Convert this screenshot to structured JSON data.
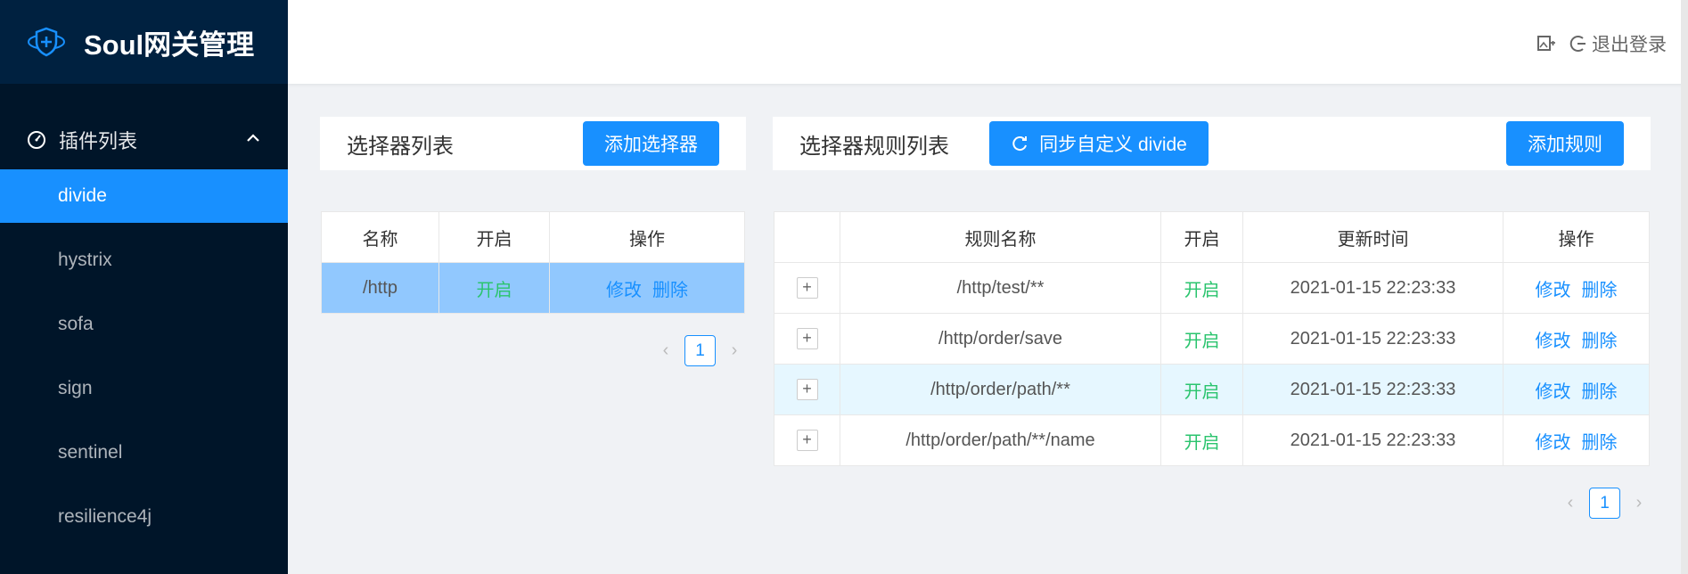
{
  "app": {
    "title": "Soul网关管理",
    "logo_icon": "shield-plus-icon"
  },
  "sidebar": {
    "group_label": "插件列表",
    "group_icon": "dashboard-icon",
    "items": [
      {
        "label": "divide",
        "active": true
      },
      {
        "label": "hystrix"
      },
      {
        "label": "sofa"
      },
      {
        "label": "sign"
      },
      {
        "label": "sentinel"
      },
      {
        "label": "resilience4j"
      }
    ]
  },
  "header": {
    "logout_label": "退出登录",
    "toggle_icon": "image-text-icon",
    "logout_icon": "logout-icon"
  },
  "selector_panel": {
    "title": "选择器列表",
    "add_button": "添加选择器",
    "columns": [
      "名称",
      "开启",
      "操作"
    ],
    "rows": [
      {
        "name": "/http",
        "enabled": "开启",
        "edit": "修改",
        "delete": "删除"
      }
    ],
    "page": "1"
  },
  "rule_panel": {
    "title": "选择器规则列表",
    "sync_button": "同步自定义 divide",
    "add_button": "添加规则",
    "columns": [
      "规则名称",
      "开启",
      "更新时间",
      "操作"
    ],
    "rows": [
      {
        "expand": "+",
        "name": "/http/test/**",
        "enabled": "开启",
        "updated": "2021-01-15 22:23:33",
        "edit": "修改",
        "delete": "删除"
      },
      {
        "expand": "+",
        "name": "/http/order/save",
        "enabled": "开启",
        "updated": "2021-01-15 22:23:33",
        "edit": "修改",
        "delete": "删除"
      },
      {
        "expand": "+",
        "name": "/http/order/path/**",
        "enabled": "开启",
        "updated": "2021-01-15 22:23:33",
        "edit": "修改",
        "delete": "删除"
      },
      {
        "expand": "+",
        "name": "/http/order/path/**/name",
        "enabled": "开启",
        "updated": "2021-01-15 22:23:33",
        "edit": "修改",
        "delete": "删除"
      }
    ],
    "page": "1"
  },
  "colors": {
    "accent": "#1890ff",
    "sidebar_bg": "#001529",
    "enabled_text": "#2bc46e"
  }
}
